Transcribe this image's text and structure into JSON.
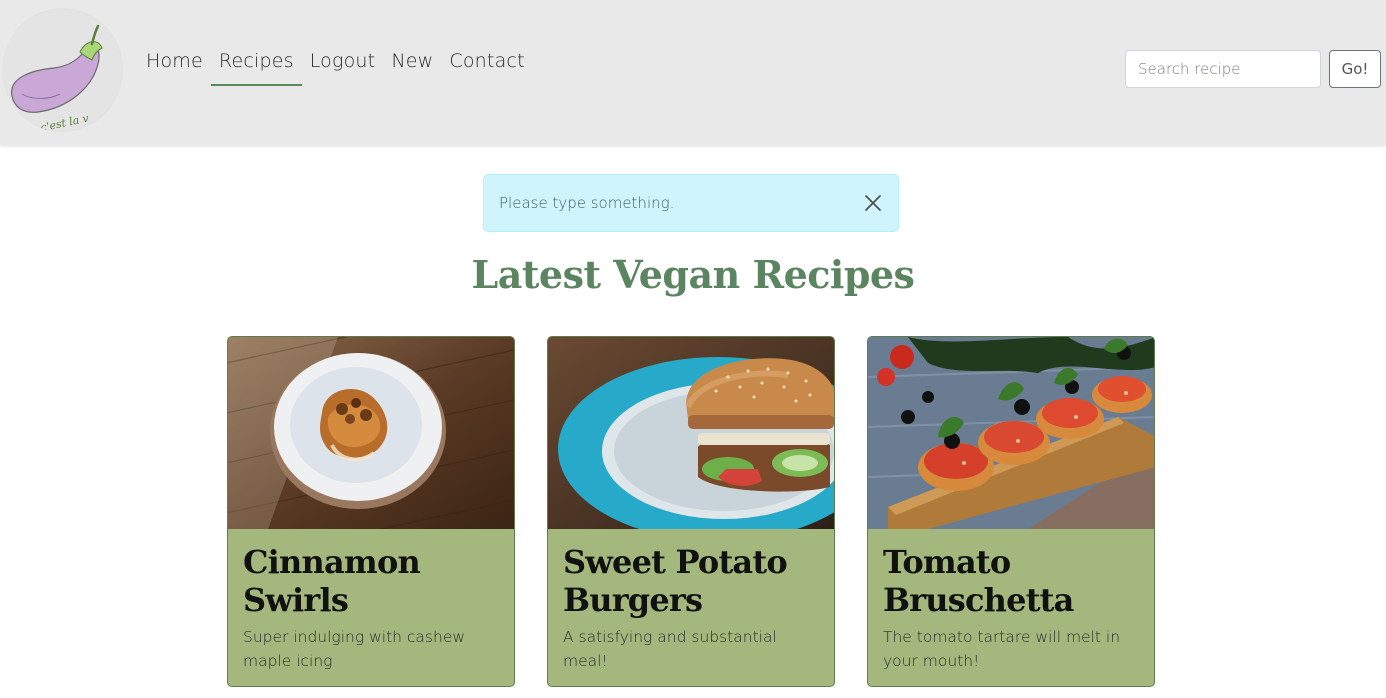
{
  "brand": {
    "logo_text": "c'est la v"
  },
  "nav": {
    "items": [
      {
        "label": "Home",
        "active": false
      },
      {
        "label": "Recipes",
        "active": true
      },
      {
        "label": "Logout",
        "active": false
      },
      {
        "label": "New",
        "active": false
      },
      {
        "label": "Contact",
        "active": false
      }
    ]
  },
  "search": {
    "placeholder": "Search recipe",
    "value": "",
    "button_label": "Go!"
  },
  "alert": {
    "message": "Please type something.",
    "close_icon": "close-icon"
  },
  "main": {
    "title": "Latest Vegan Recipes"
  },
  "recipes": [
    {
      "title": "Cinnamon Swirls",
      "description": "Super indulging with cashew maple icing",
      "image": "cinnamon-swirl-photo"
    },
    {
      "title": "Sweet Potato Burgers",
      "description": "A satisfying and substantial meal!",
      "image": "burger-photo"
    },
    {
      "title": "Tomato Bruschetta",
      "description": "The tomato tartare will melt in your mouth!",
      "image": "bruschetta-photo"
    }
  ],
  "colors": {
    "accent_green": "#5a8560",
    "card_bg": "#a4b87e",
    "navbar_bg": "#e9e9e9",
    "alert_bg": "#cff4fc"
  }
}
